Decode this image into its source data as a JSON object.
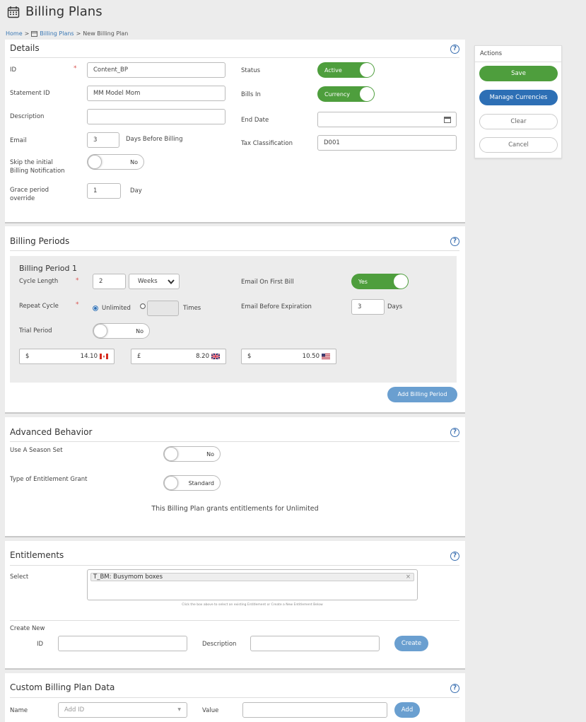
{
  "page": {
    "title": "Billing Plans",
    "icon": "calendar-icon"
  },
  "breadcrumb": {
    "home": "Home",
    "sep1": ">",
    "billing_plans": "Billing Plans",
    "sep2": ">",
    "current": "New Billing Plan"
  },
  "details": {
    "title": "Details",
    "id_label": "ID",
    "id_value": "Content_BP",
    "statement_id_label": "Statement ID",
    "statement_id_value": "MM Model Mom",
    "description_label": "Description",
    "description_value": "",
    "email_label": "Email",
    "email_value": "3",
    "email_suffix": "Days Before Billing",
    "skip_label_1": "Skip the initial",
    "skip_label_2": "Billing Notification",
    "skip_toggle": "No",
    "grace_label_1": "Grace period",
    "grace_label_2": "override",
    "grace_value": "1",
    "grace_suffix": "Day",
    "status_label": "Status",
    "status_toggle": "Active",
    "bills_in_label": "Bills In",
    "bills_in_toggle": "Currency",
    "end_date_label": "End Date",
    "end_date_value": "",
    "tax_label": "Tax Classification",
    "tax_value": "D001"
  },
  "actions": {
    "title": "Actions",
    "save": "Save",
    "manage_currencies": "Manage Currencies",
    "clear": "Clear",
    "cancel": "Cancel"
  },
  "billing_periods": {
    "title": "Billing Periods",
    "period_title": "Billing Period 1",
    "cycle_length_label": "Cycle Length",
    "cycle_length_value": "2",
    "cycle_unit": "Weeks",
    "repeat_cycle_label": "Repeat Cycle",
    "unlimited_label": "Unlimited",
    "times_label": "Times",
    "trial_label": "Trial Period",
    "trial_toggle": "No",
    "email_first_bill_label": "Email On First Bill",
    "email_first_bill_toggle": "Yes",
    "email_before_exp_label": "Email Before Expiration",
    "email_before_exp_value": "3",
    "email_before_exp_suffix": "Days",
    "prices": [
      {
        "symbol": "$",
        "amount": "14.10",
        "flag": "canada-flag-icon"
      },
      {
        "symbol": "£",
        "amount": "8.20",
        "flag": "uk-flag-icon"
      },
      {
        "symbol": "$",
        "amount": "10.50",
        "flag": "us-flag-icon"
      }
    ],
    "add_button": "Add Billing Period"
  },
  "advanced": {
    "title": "Advanced Behavior",
    "season_label": "Use A Season Set",
    "season_toggle": "No",
    "grant_label": "Type of Entitlement Grant",
    "grant_toggle": "Standard",
    "note": "This Billing Plan grants entitlements for Unlimited"
  },
  "entitlements": {
    "title": "Entitlements",
    "select_label": "Select",
    "selected_tag": "T_BM: Busymom boxes",
    "tag_remove": "×",
    "hint": "Click the box above to select an existing Entitlement or Create a New Entitlement Below",
    "create_new_label": "Create New",
    "id_label": "ID",
    "description_label": "Description",
    "create_button": "Create"
  },
  "custom_data": {
    "title": "Custom Billing Plan Data",
    "name_label": "Name",
    "name_placeholder": "Add ID",
    "value_label": "Value",
    "add_button": "Add"
  },
  "colors": {
    "green": "#4e9e3d",
    "blue": "#2d6fb5",
    "light_blue": "#6a9fd0",
    "link": "#3a78b5"
  }
}
